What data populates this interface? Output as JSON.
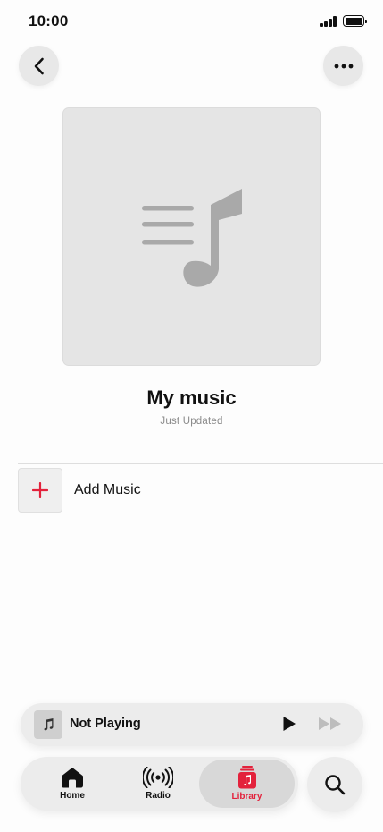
{
  "status_bar": {
    "time": "10:00"
  },
  "nav": {
    "back_icon": "chevron-left-icon",
    "more_icon": "ellipsis-icon"
  },
  "playlist": {
    "artwork_icon": "playlist-music-icon",
    "title": "My music",
    "subtitle": "Just Updated"
  },
  "add_music": {
    "label": "Add Music",
    "icon": "plus-icon"
  },
  "mini_player": {
    "title": "Not Playing"
  },
  "tabs": [
    {
      "label": "Home",
      "icon": "home-icon",
      "selected": false
    },
    {
      "label": "Radio",
      "icon": "radio-icon",
      "selected": false
    },
    {
      "label": "Library",
      "icon": "library-icon",
      "selected": true
    }
  ],
  "colors": {
    "accent": "#e3223c",
    "background": "#fdfdfd",
    "control": "#ececec"
  }
}
